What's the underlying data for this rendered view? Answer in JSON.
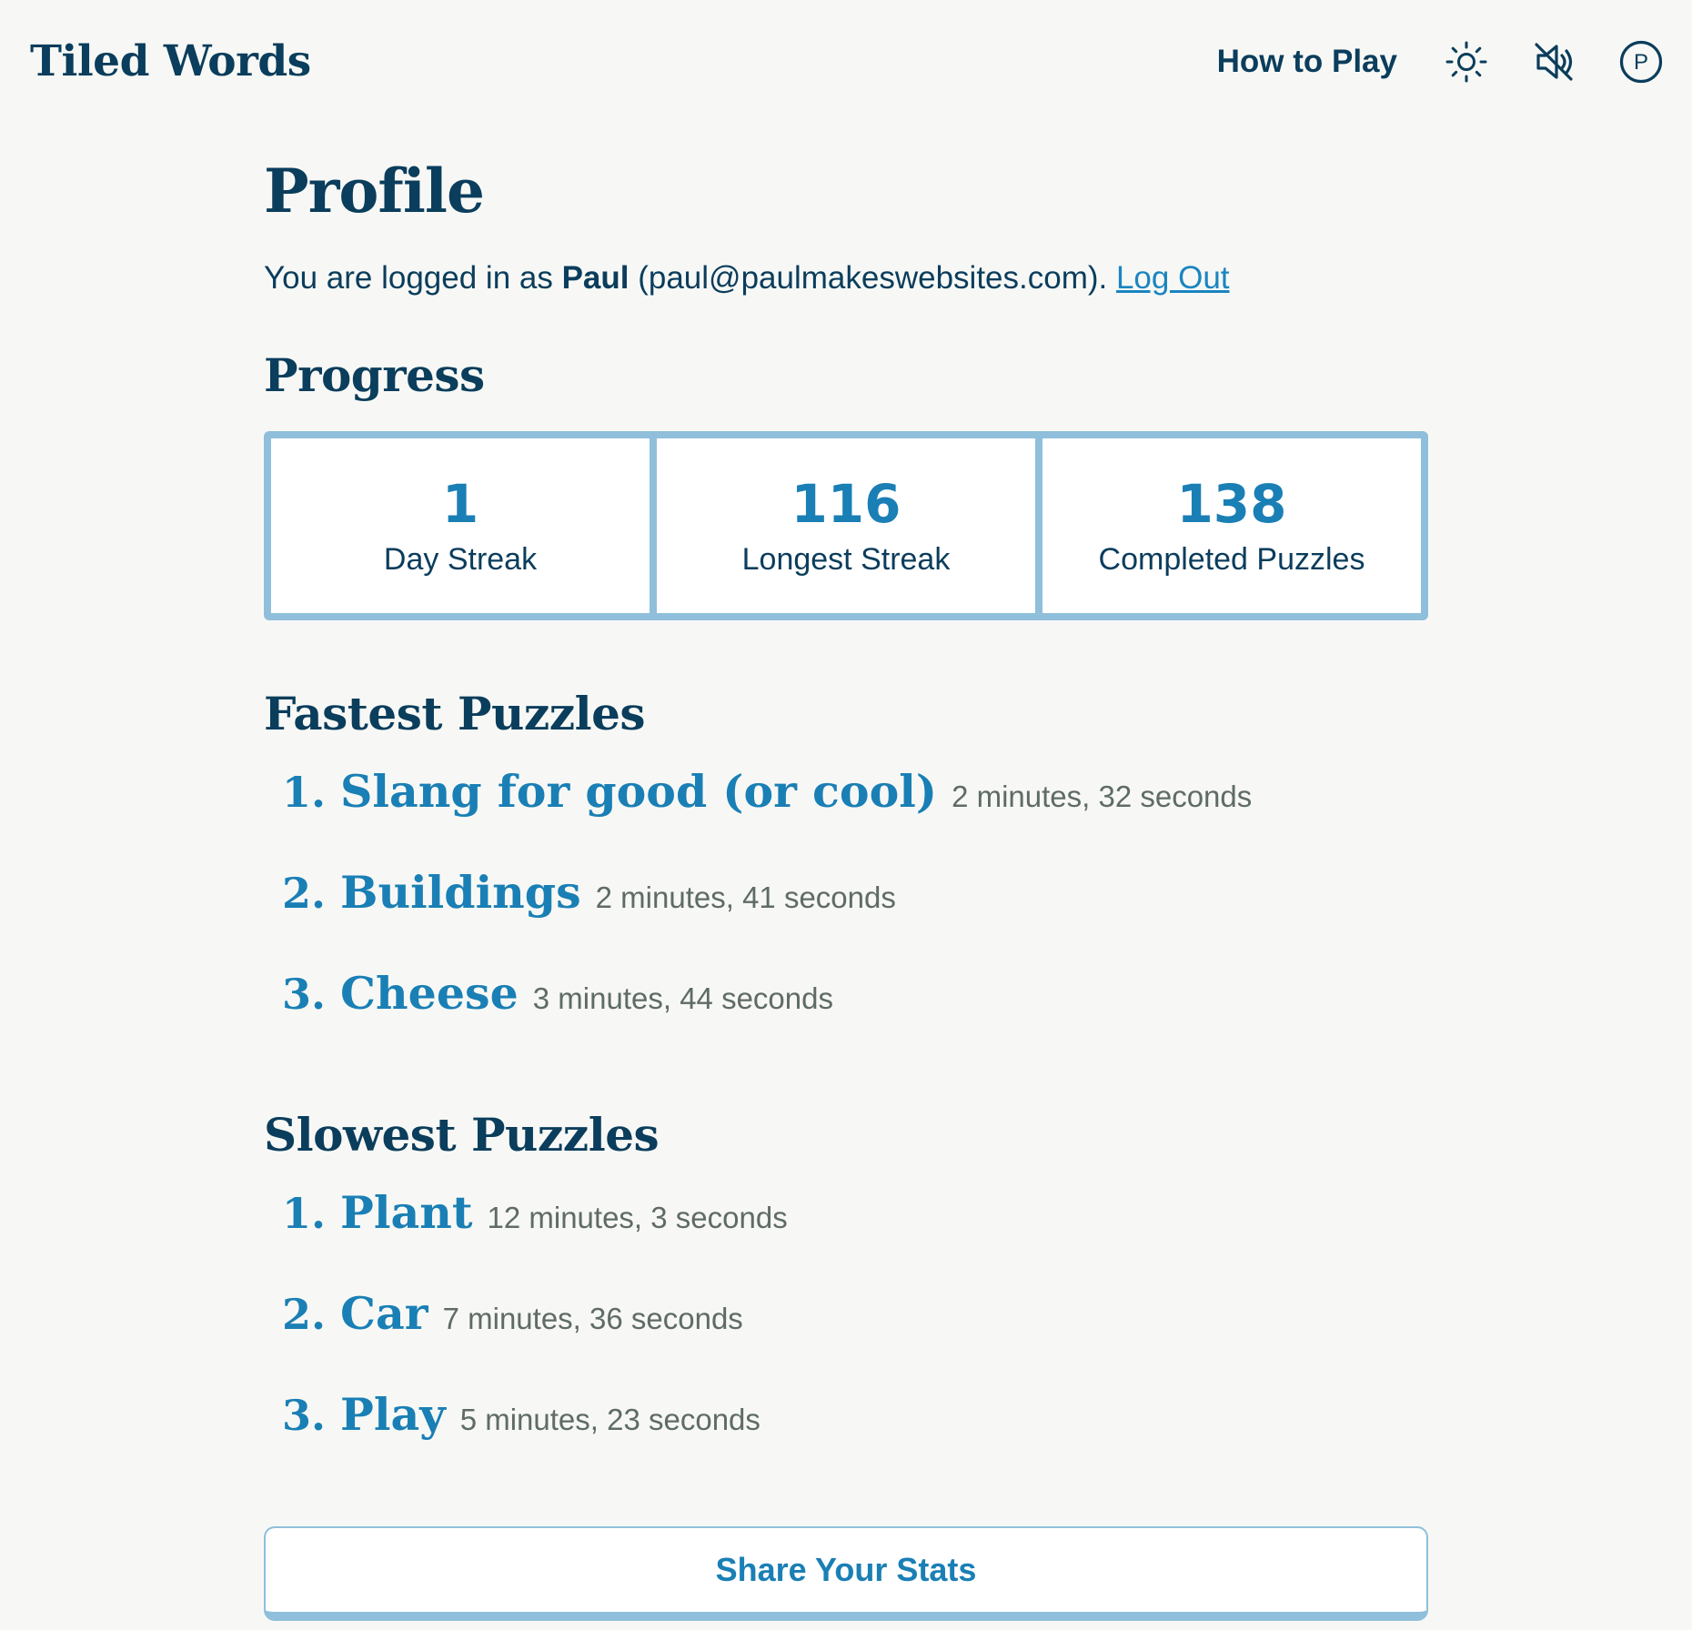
{
  "header": {
    "brand": "Tiled Words",
    "how_to_play": "How to Play",
    "profile_initial": "P"
  },
  "profile": {
    "title": "Profile",
    "login_prefix": "You are logged in as ",
    "username": "Paul",
    "email_part": " (paul@paulmakeswebsites.com). ",
    "logout_label": "Log Out"
  },
  "progress": {
    "title": "Progress",
    "stats": [
      {
        "value": "1",
        "label": "Day Streak"
      },
      {
        "value": "116",
        "label": "Longest Streak"
      },
      {
        "value": "138",
        "label": "Completed Puzzles"
      }
    ]
  },
  "fastest": {
    "title": "Fastest Puzzles",
    "items": [
      {
        "rank": "1.",
        "name": "Slang for good (or cool)",
        "time": "2 minutes, 32 seconds"
      },
      {
        "rank": "2.",
        "name": "Buildings",
        "time": "2 minutes, 41 seconds"
      },
      {
        "rank": "3.",
        "name": "Cheese",
        "time": "3 minutes, 44 seconds"
      }
    ]
  },
  "slowest": {
    "title": "Slowest Puzzles",
    "items": [
      {
        "rank": "1.",
        "name": "Plant",
        "time": "12 minutes, 3 seconds"
      },
      {
        "rank": "2.",
        "name": "Car",
        "time": "7 minutes, 36 seconds"
      },
      {
        "rank": "3.",
        "name": "Play",
        "time": "5 minutes, 23 seconds"
      }
    ]
  },
  "share_label": "Share Your Stats",
  "colors": {
    "navy": "#0b3d5c",
    "accent": "#1a7fb5",
    "link": "#1a85c0",
    "border": "#8fbfdb",
    "muted": "#5f6b66",
    "background": "#f7f8f5"
  },
  "icons": [
    "sun-icon",
    "speaker-muted-icon",
    "profile-avatar-icon"
  ]
}
